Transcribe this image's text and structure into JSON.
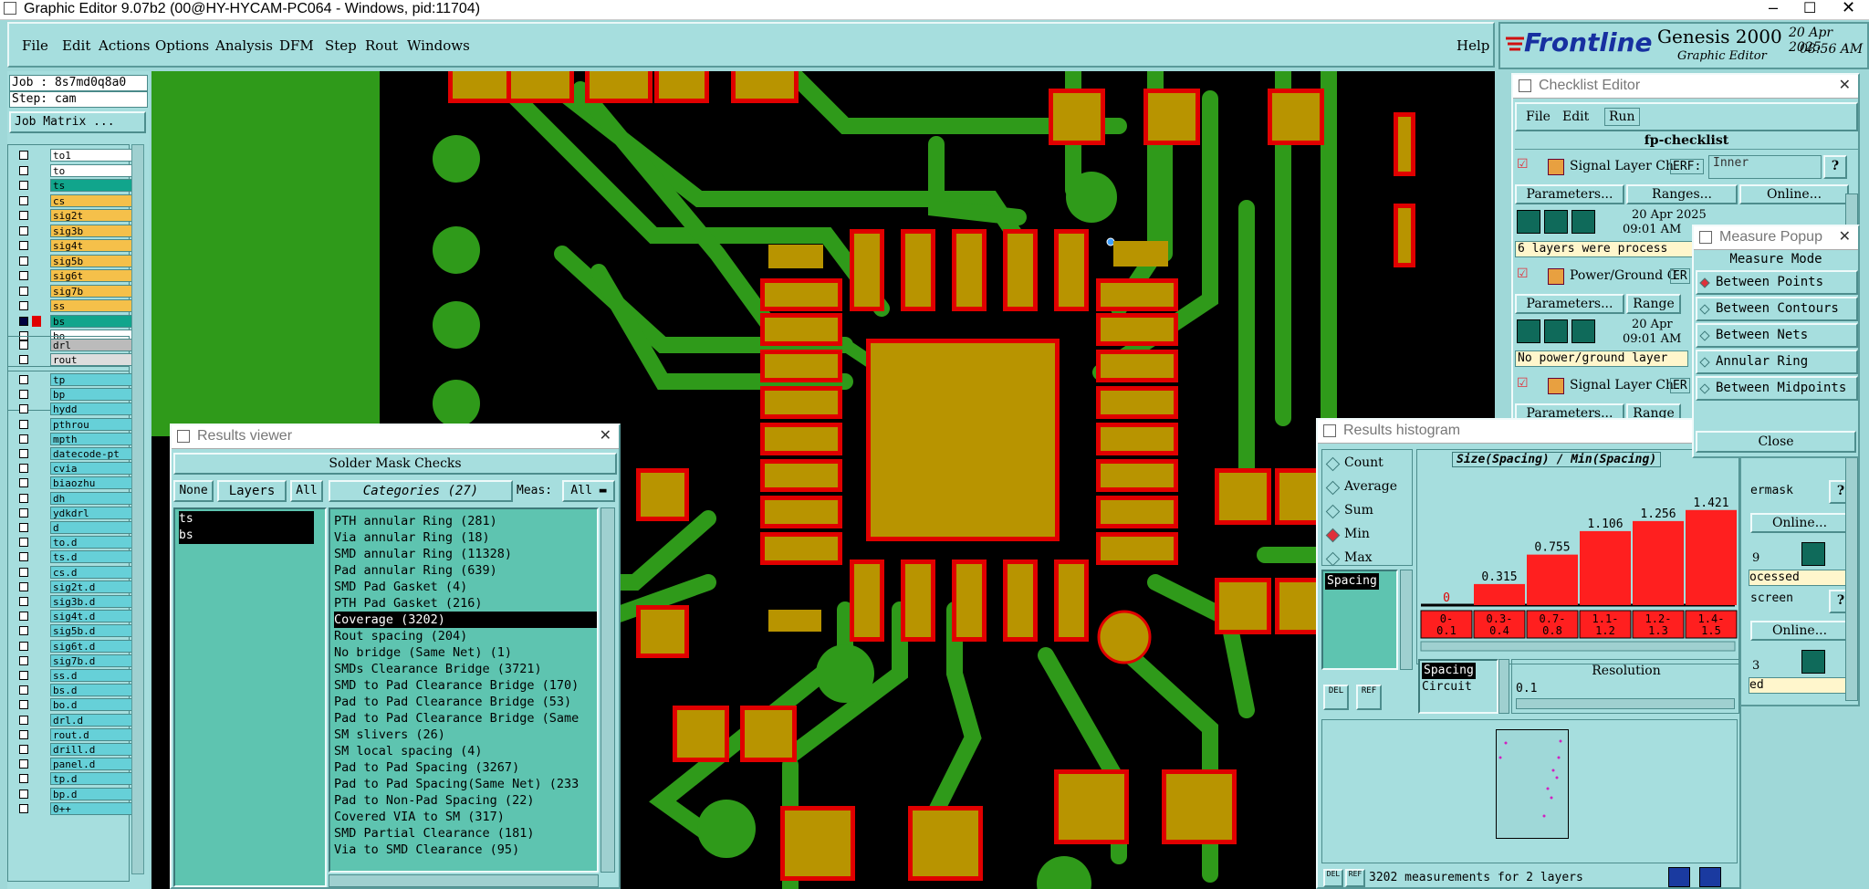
{
  "window": {
    "title": "Graphic Editor 9.07b2 (00@HY-HYCAM-PC064 - Windows, pid:11704)"
  },
  "menu": {
    "items": [
      "File",
      "Edit",
      "Actions",
      "Options",
      "Analysis",
      "DFM",
      "Step",
      "Rout",
      "Windows"
    ],
    "help": "Help"
  },
  "brand": {
    "logo": "Frontline",
    "product": "Genesis 2000",
    "subtitle": "Graphic Editor",
    "date": "20 Apr 2025",
    "time": "08:56 AM"
  },
  "job": {
    "job": "Job : 8s7md0q8a0",
    "step": "Step: cam",
    "matrix_btn": "Job Matrix ..."
  },
  "layers_top": [
    {
      "name": "to1",
      "color": "#ffffff"
    },
    {
      "name": "to",
      "color": "#ffffff"
    },
    {
      "name": "ts",
      "color": "#11a58c"
    },
    {
      "name": "cs",
      "color": "#f5c04a"
    },
    {
      "name": "sig2t",
      "color": "#f5c04a"
    },
    {
      "name": "sig3b",
      "color": "#f5c04a"
    },
    {
      "name": "sig4t",
      "color": "#f5c04a"
    },
    {
      "name": "sig5b",
      "color": "#f5c04a"
    },
    {
      "name": "sig6t",
      "color": "#f5c04a"
    },
    {
      "name": "sig7b",
      "color": "#f5c04a"
    },
    {
      "name": "ss",
      "color": "#f5c04a"
    },
    {
      "name": "bs",
      "color": "#11a58c"
    },
    {
      "name": "bo",
      "color": "#ffffff"
    }
  ],
  "layers_mid": [
    {
      "name": "drl",
      "color": "#bbbbbb"
    },
    {
      "name": "rout",
      "color": "#dddddd"
    }
  ],
  "layers_bottom": [
    "tp",
    "bp",
    "hydd",
    "pthrou",
    "mpth",
    "datecode-pt",
    "cvia",
    "biaozhu",
    "dh",
    "ydkdrl",
    "d",
    "to.d",
    "ts.d",
    "cs.d",
    "sig2t.d",
    "sig3b.d",
    "sig4t.d",
    "sig5b.d",
    "sig6t.d",
    "sig7b.d",
    "ss.d",
    "bs.d",
    "bo.d",
    "drl.d",
    "rout.d",
    "drill.d",
    "panel.d",
    "tp.d",
    "bp.d",
    "0++"
  ],
  "results_viewer": {
    "title": "Results viewer",
    "header": "Solder Mask Checks",
    "none_btn": "None",
    "layers_btn": "Layers",
    "all_btn": "All",
    "categories_btn": "Categories (27)",
    "meas_label": "Meas:",
    "meas_value": "All",
    "selected_layers": [
      "ts",
      "bs"
    ],
    "categories": [
      "PTH annular Ring (281)",
      "Via annular Ring (18)",
      "SMD annular Ring (11328)",
      "Pad annular Ring (639)",
      "SMD Pad Gasket (4)",
      "PTH Pad Gasket (216)",
      "Coverage (3202)",
      "Rout spacing (204)",
      "No bridge (Same Net) (1)",
      "SMDs Clearance Bridge (3721)",
      "SMD to Pad Clearance Bridge (170)",
      "Pad to Pad Clearance Bridge (53)",
      "Pad to Pad Clearance Bridge (Same",
      "SM slivers (26)",
      "SM local spacing (4)",
      "Pad to Pad Spacing (3267)",
      "Pad to Pad Spacing(Same Net) (233",
      "Pad to Non-Pad Spacing (22)",
      "Covered VIA to SM (317)",
      "SMD Partial Clearance (181)",
      "Via to SMD Clearance (95)"
    ],
    "selected_index": 6
  },
  "checklist": {
    "title": "Checklist Editor",
    "menu": [
      "File",
      "Edit",
      "Run"
    ],
    "name": "fp-checklist",
    "rows": [
      {
        "label": "Signal Layer Ch",
        "erf": "ERF:",
        "erf_value": "Inner",
        "params": "Parameters...",
        "ranges": "Ranges...",
        "online": "Online...",
        "date": "20 Apr 2025",
        "time": "09:01 AM",
        "status": "6 layers were process"
      },
      {
        "label": "Power/Ground C",
        "erf": "ER",
        "params": "Parameters...",
        "ranges": "Range",
        "date": "20 Apr",
        "time": "09:01 AM",
        "status": "No power/ground layer"
      },
      {
        "label": "Signal Layer Ch",
        "erf": "ER",
        "params": "Parameters...",
        "ranges": "Range"
      }
    ],
    "right_frag": {
      "ermask": "ermask",
      "online1": "Online...",
      "n9": "9",
      "ocessed": "ocessed",
      "screen": "screen",
      "online2": "Online...",
      "n3": "3",
      "ed": "ed"
    }
  },
  "measure": {
    "title": "Measure Popup",
    "mode_label": "Measure Mode",
    "modes": [
      "Between Points",
      "Between Contours",
      "Between Nets",
      "Annular Ring",
      "Between Midpoints"
    ],
    "active": 0,
    "close": "Close"
  },
  "histogram": {
    "title": "Results histogram",
    "options": [
      "Count",
      "Average",
      "Sum",
      "Min",
      "Max"
    ],
    "active_option": 3,
    "list_item": "Spacing",
    "chart_title": "Size(Spacing) / Min(Spacing)",
    "spacing_label": "Spacing",
    "circuit_label": "Circuit",
    "resolution_label": "Resolution",
    "resolution_value": "0.1",
    "status": "3202 measurements for 2 layers",
    "del": "DEL",
    "ref": "REF"
  },
  "chart_data": {
    "type": "bar",
    "categories": [
      "0-\n0.1",
      "0.3-\n0.4",
      "0.7-\n0.8",
      "1.1-\n1.2",
      "1.2-\n1.3",
      "1.4-\n1.5"
    ],
    "values": [
      0,
      0.315,
      0.755,
      1.106,
      1.256,
      1.421
    ],
    "title": "Size(Spacing) / Min(Spacing)",
    "bar_color": "#ff1f1f"
  }
}
